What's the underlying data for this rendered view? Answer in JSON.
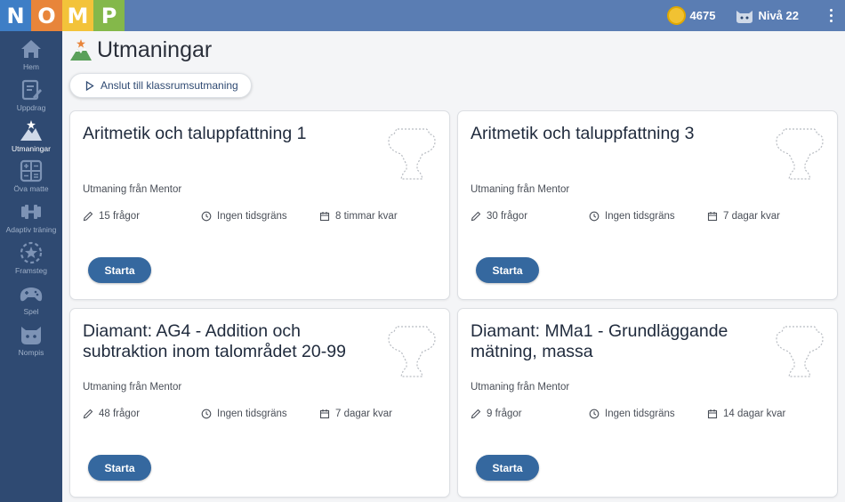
{
  "logo": {
    "letters": [
      "N",
      "O",
      "M",
      "P"
    ],
    "colors": [
      "#3e7ec6",
      "#e8853a",
      "#f3c33a",
      "#84b84a"
    ]
  },
  "topbar": {
    "coins": "4675",
    "level": "Nivå 22",
    "coin_icon": "coin-icon",
    "avatar_icon": "cat-avatar-icon",
    "menu_icon": "kebab-menu-icon"
  },
  "sidebar": {
    "items": [
      {
        "label": "Hem",
        "icon": "home-icon"
      },
      {
        "label": "Uppdrag",
        "icon": "assignment-icon"
      },
      {
        "label": "Utmaningar",
        "icon": "mountain-star-icon",
        "active": true
      },
      {
        "label": "Öva matte",
        "icon": "calculator-icon"
      },
      {
        "label": "Adaptiv träning",
        "icon": "dumbbell-icon"
      },
      {
        "label": "Framsteg",
        "icon": "progress-star-icon"
      },
      {
        "label": "Spel",
        "icon": "gamepad-icon"
      },
      {
        "label": "Nompis",
        "icon": "cat-icon"
      }
    ]
  },
  "page": {
    "title": "Utmaningar",
    "join_button": "Anslut till klassrumsutmaning"
  },
  "cards": [
    {
      "title": "Aritmetik och taluppfattning 1",
      "from": "Utmaning från Mentor",
      "questions": "15 frågor",
      "time": "Ingen tidsgräns",
      "remaining": "8 timmar kvar",
      "button": "Starta"
    },
    {
      "title": "Aritmetik och taluppfattning 3",
      "from": "Utmaning från Mentor",
      "questions": "30 frågor",
      "time": "Ingen tidsgräns",
      "remaining": "7 dagar kvar",
      "button": "Starta"
    },
    {
      "title": "Diamant: AG4 - Addition och subtraktion inom talområdet 20-99",
      "from": "Utmaning från Mentor",
      "questions": "48 frågor",
      "time": "Ingen tidsgräns",
      "remaining": "7 dagar kvar",
      "button": "Starta"
    },
    {
      "title": "Diamant: MMa1 - Grundläggande mätning, massa",
      "from": "Utmaning från Mentor",
      "questions": "9 frågor",
      "time": "Ingen tidsgräns",
      "remaining": "14 dagar kvar",
      "button": "Starta"
    }
  ],
  "colors": {
    "accent": "#35689f",
    "topbar": "#5a7db3",
    "sidebar": "#2f4a72"
  }
}
